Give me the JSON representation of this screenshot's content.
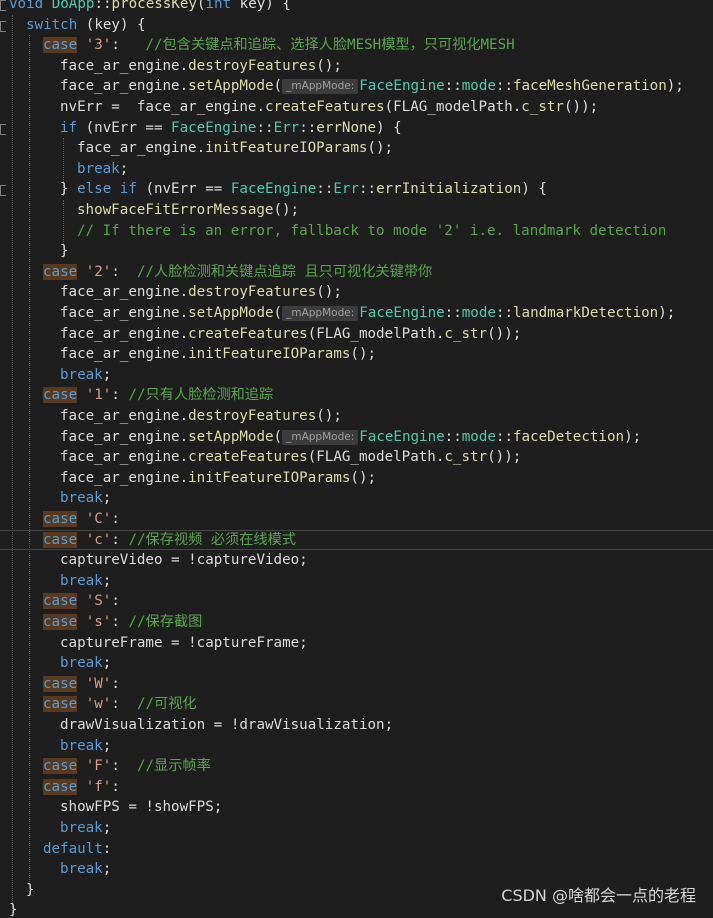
{
  "editor": {
    "colors": {
      "background": "#1e1e1e",
      "keyword": "#569cd6",
      "type": "#4ec9b0",
      "function": "#dcdcaa",
      "string": "#d69d85",
      "comment": "#57a64a",
      "text": "#dcdcdc",
      "case_highlight": "#623a1e",
      "param_hint": "#3c3c3c"
    },
    "current_line_index": 26,
    "lines": [
      {
        "indent": 0,
        "tokens": [
          {
            "t": "void ",
            "c": "kw"
          },
          {
            "t": "DoApp",
            "c": "cn"
          },
          {
            "t": "::",
            "c": "plain"
          },
          {
            "t": "processKey",
            "c": "fn"
          },
          {
            "t": "(",
            "c": "plain"
          },
          {
            "t": "int ",
            "c": "kw"
          },
          {
            "t": "key) {",
            "c": "plain"
          }
        ]
      },
      {
        "indent": 1,
        "tokens": [
          {
            "t": "switch ",
            "c": "kw"
          },
          {
            "t": "(key) {",
            "c": "plain"
          }
        ]
      },
      {
        "indent": 2,
        "tokens": [
          {
            "t": "case",
            "c": "casekw"
          },
          {
            "t": " ",
            "c": "plain"
          },
          {
            "t": "'3'",
            "c": "str"
          },
          {
            "t": ":   ",
            "c": "plain"
          },
          {
            "t": "//包含关键点和追踪、选择人脸MESH模型，只可视化MESH",
            "c": "cmt"
          }
        ]
      },
      {
        "indent": 3,
        "tokens": [
          {
            "t": "face_ar_engine.",
            "c": "plain"
          },
          {
            "t": "destroyFeatures",
            "c": "fn"
          },
          {
            "t": "();",
            "c": "plain"
          }
        ]
      },
      {
        "indent": 3,
        "tokens": [
          {
            "t": "face_ar_engine.",
            "c": "plain"
          },
          {
            "t": "setAppMode",
            "c": "fn"
          },
          {
            "t": "(",
            "c": "plain"
          },
          {
            "t": "_mAppMode:",
            "c": "hint"
          },
          {
            "t": "FaceEngine",
            "c": "cn"
          },
          {
            "t": "::",
            "c": "plain"
          },
          {
            "t": "mode",
            "c": "cn"
          },
          {
            "t": "::",
            "c": "plain"
          },
          {
            "t": "faceMeshGeneration",
            "c": "fn"
          },
          {
            "t": ");",
            "c": "plain"
          }
        ]
      },
      {
        "indent": 3,
        "tokens": [
          {
            "t": "nvErr =  face_ar_engine.",
            "c": "plain"
          },
          {
            "t": "createFeatures",
            "c": "fn"
          },
          {
            "t": "(FLAG_modelPath.",
            "c": "plain"
          },
          {
            "t": "c_str",
            "c": "fn"
          },
          {
            "t": "());",
            "c": "plain"
          }
        ]
      },
      {
        "indent": 3,
        "tokens": [
          {
            "t": "if ",
            "c": "kw"
          },
          {
            "t": "(nvErr == ",
            "c": "plain"
          },
          {
            "t": "FaceEngine",
            "c": "cn"
          },
          {
            "t": "::",
            "c": "plain"
          },
          {
            "t": "Err",
            "c": "cn"
          },
          {
            "t": "::",
            "c": "plain"
          },
          {
            "t": "errNone",
            "c": "fn"
          },
          {
            "t": ") {",
            "c": "plain"
          }
        ]
      },
      {
        "indent": 4,
        "tokens": [
          {
            "t": "face_ar_engine.",
            "c": "plain"
          },
          {
            "t": "initFeatureIOParams",
            "c": "fn"
          },
          {
            "t": "();",
            "c": "plain"
          }
        ]
      },
      {
        "indent": 4,
        "tokens": [
          {
            "t": "break",
            "c": "kw"
          },
          {
            "t": ";",
            "c": "plain"
          }
        ]
      },
      {
        "indent": 3,
        "tokens": [
          {
            "t": "} ",
            "c": "plain"
          },
          {
            "t": "else if ",
            "c": "kw"
          },
          {
            "t": "(nvErr == ",
            "c": "plain"
          },
          {
            "t": "FaceEngine",
            "c": "cn"
          },
          {
            "t": "::",
            "c": "plain"
          },
          {
            "t": "Err",
            "c": "cn"
          },
          {
            "t": "::",
            "c": "plain"
          },
          {
            "t": "errInitialization",
            "c": "fn"
          },
          {
            "t": ") {",
            "c": "plain"
          }
        ]
      },
      {
        "indent": 4,
        "tokens": [
          {
            "t": "showFaceFitErrorMessage",
            "c": "fn"
          },
          {
            "t": "();",
            "c": "plain"
          }
        ]
      },
      {
        "indent": 4,
        "tokens": [
          {
            "t": "// If there is an error, fallback to mode '2' i.e. landmark detection",
            "c": "cmt"
          }
        ]
      },
      {
        "indent": 3,
        "tokens": [
          {
            "t": "}",
            "c": "plain"
          }
        ]
      },
      {
        "indent": 2,
        "tokens": [
          {
            "t": "case",
            "c": "casekw"
          },
          {
            "t": " ",
            "c": "plain"
          },
          {
            "t": "'2'",
            "c": "str"
          },
          {
            "t": ":  ",
            "c": "plain"
          },
          {
            "t": "//人脸检测和关键点追踪 且只可视化关键带你",
            "c": "cmt"
          }
        ]
      },
      {
        "indent": 3,
        "tokens": [
          {
            "t": "face_ar_engine.",
            "c": "plain"
          },
          {
            "t": "destroyFeatures",
            "c": "fn"
          },
          {
            "t": "();",
            "c": "plain"
          }
        ]
      },
      {
        "indent": 3,
        "tokens": [
          {
            "t": "face_ar_engine.",
            "c": "plain"
          },
          {
            "t": "setAppMode",
            "c": "fn"
          },
          {
            "t": "(",
            "c": "plain"
          },
          {
            "t": "_mAppMode:",
            "c": "hint"
          },
          {
            "t": "FaceEngine",
            "c": "cn"
          },
          {
            "t": "::",
            "c": "plain"
          },
          {
            "t": "mode",
            "c": "cn"
          },
          {
            "t": "::",
            "c": "plain"
          },
          {
            "t": "landmarkDetection",
            "c": "fn"
          },
          {
            "t": ");",
            "c": "plain"
          }
        ]
      },
      {
        "indent": 3,
        "tokens": [
          {
            "t": "face_ar_engine.",
            "c": "plain"
          },
          {
            "t": "createFeatures",
            "c": "fn"
          },
          {
            "t": "(FLAG_modelPath.",
            "c": "plain"
          },
          {
            "t": "c_str",
            "c": "fn"
          },
          {
            "t": "());",
            "c": "plain"
          }
        ]
      },
      {
        "indent": 3,
        "tokens": [
          {
            "t": "face_ar_engine.",
            "c": "plain"
          },
          {
            "t": "initFeatureIOParams",
            "c": "fn"
          },
          {
            "t": "();",
            "c": "plain"
          }
        ]
      },
      {
        "indent": 3,
        "tokens": [
          {
            "t": "break",
            "c": "kw"
          },
          {
            "t": ";",
            "c": "plain"
          }
        ]
      },
      {
        "indent": 2,
        "tokens": [
          {
            "t": "case",
            "c": "casekw"
          },
          {
            "t": " ",
            "c": "plain"
          },
          {
            "t": "'1'",
            "c": "str"
          },
          {
            "t": ": ",
            "c": "plain"
          },
          {
            "t": "//只有人脸检测和追踪",
            "c": "cmt"
          }
        ]
      },
      {
        "indent": 3,
        "tokens": [
          {
            "t": "face_ar_engine.",
            "c": "plain"
          },
          {
            "t": "destroyFeatures",
            "c": "fn"
          },
          {
            "t": "();",
            "c": "plain"
          }
        ]
      },
      {
        "indent": 3,
        "tokens": [
          {
            "t": "face_ar_engine.",
            "c": "plain"
          },
          {
            "t": "setAppMode",
            "c": "fn"
          },
          {
            "t": "(",
            "c": "plain"
          },
          {
            "t": "_mAppMode:",
            "c": "hint"
          },
          {
            "t": "FaceEngine",
            "c": "cn"
          },
          {
            "t": "::",
            "c": "plain"
          },
          {
            "t": "mode",
            "c": "cn"
          },
          {
            "t": "::",
            "c": "plain"
          },
          {
            "t": "faceDetection",
            "c": "fn"
          },
          {
            "t": ");",
            "c": "plain"
          }
        ]
      },
      {
        "indent": 3,
        "tokens": [
          {
            "t": "face_ar_engine.",
            "c": "plain"
          },
          {
            "t": "createFeatures",
            "c": "fn"
          },
          {
            "t": "(FLAG_modelPath.",
            "c": "plain"
          },
          {
            "t": "c_str",
            "c": "fn"
          },
          {
            "t": "());",
            "c": "plain"
          }
        ]
      },
      {
        "indent": 3,
        "tokens": [
          {
            "t": "face_ar_engine.",
            "c": "plain"
          },
          {
            "t": "initFeatureIOParams",
            "c": "fn"
          },
          {
            "t": "();",
            "c": "plain"
          }
        ]
      },
      {
        "indent": 3,
        "tokens": [
          {
            "t": "break",
            "c": "kw"
          },
          {
            "t": ";",
            "c": "plain"
          }
        ]
      },
      {
        "indent": 2,
        "tokens": [
          {
            "t": "case",
            "c": "casekw"
          },
          {
            "t": " ",
            "c": "plain"
          },
          {
            "t": "'C'",
            "c": "str"
          },
          {
            "t": ":",
            "c": "plain"
          }
        ]
      },
      {
        "indent": 2,
        "tokens": [
          {
            "t": "case",
            "c": "casekw"
          },
          {
            "t": " ",
            "c": "plain"
          },
          {
            "t": "'c'",
            "c": "str"
          },
          {
            "t": ": ",
            "c": "plain"
          },
          {
            "t": "//保存视频 必须在线模式",
            "c": "cmt"
          }
        ]
      },
      {
        "indent": 3,
        "tokens": [
          {
            "t": "captureVideo = !captureVideo;",
            "c": "plain"
          }
        ]
      },
      {
        "indent": 3,
        "tokens": [
          {
            "t": "break",
            "c": "kw"
          },
          {
            "t": ";",
            "c": "plain"
          }
        ]
      },
      {
        "indent": 2,
        "tokens": [
          {
            "t": "case",
            "c": "casekw"
          },
          {
            "t": " ",
            "c": "plain"
          },
          {
            "t": "'S'",
            "c": "str"
          },
          {
            "t": ":",
            "c": "plain"
          }
        ]
      },
      {
        "indent": 2,
        "tokens": [
          {
            "t": "case",
            "c": "casekw"
          },
          {
            "t": " ",
            "c": "plain"
          },
          {
            "t": "'s'",
            "c": "str"
          },
          {
            "t": ": ",
            "c": "plain"
          },
          {
            "t": "//保存截图",
            "c": "cmt"
          }
        ]
      },
      {
        "indent": 3,
        "tokens": [
          {
            "t": "captureFrame = !captureFrame;",
            "c": "plain"
          }
        ]
      },
      {
        "indent": 3,
        "tokens": [
          {
            "t": "break",
            "c": "kw"
          },
          {
            "t": ";",
            "c": "plain"
          }
        ]
      },
      {
        "indent": 2,
        "tokens": [
          {
            "t": "case",
            "c": "casekw"
          },
          {
            "t": " ",
            "c": "plain"
          },
          {
            "t": "'W'",
            "c": "str"
          },
          {
            "t": ":",
            "c": "plain"
          }
        ]
      },
      {
        "indent": 2,
        "tokens": [
          {
            "t": "case",
            "c": "casekw"
          },
          {
            "t": " ",
            "c": "plain"
          },
          {
            "t": "'w'",
            "c": "str"
          },
          {
            "t": ":  ",
            "c": "plain"
          },
          {
            "t": "//可视化",
            "c": "cmt"
          }
        ]
      },
      {
        "indent": 3,
        "tokens": [
          {
            "t": "drawVisualization = !drawVisualization;",
            "c": "plain"
          }
        ]
      },
      {
        "indent": 3,
        "tokens": [
          {
            "t": "break",
            "c": "kw"
          },
          {
            "t": ";",
            "c": "plain"
          }
        ]
      },
      {
        "indent": 2,
        "tokens": [
          {
            "t": "case",
            "c": "casekw"
          },
          {
            "t": " ",
            "c": "plain"
          },
          {
            "t": "'F'",
            "c": "str"
          },
          {
            "t": ":  ",
            "c": "plain"
          },
          {
            "t": "//显示帧率",
            "c": "cmt"
          }
        ]
      },
      {
        "indent": 2,
        "tokens": [
          {
            "t": "case",
            "c": "casekw"
          },
          {
            "t": " ",
            "c": "plain"
          },
          {
            "t": "'f'",
            "c": "str"
          },
          {
            "t": ":",
            "c": "plain"
          }
        ]
      },
      {
        "indent": 3,
        "tokens": [
          {
            "t": "showFPS = !showFPS;",
            "c": "plain"
          }
        ]
      },
      {
        "indent": 3,
        "tokens": [
          {
            "t": "break",
            "c": "kw"
          },
          {
            "t": ";",
            "c": "plain"
          }
        ]
      },
      {
        "indent": 2,
        "tokens": [
          {
            "t": "default",
            "c": "kw"
          },
          {
            "t": ":",
            "c": "plain"
          }
        ]
      },
      {
        "indent": 3,
        "tokens": [
          {
            "t": "break",
            "c": "kw"
          },
          {
            "t": ";",
            "c": "plain"
          }
        ]
      },
      {
        "indent": 1,
        "tokens": [
          {
            "t": "}",
            "c": "plain"
          }
        ]
      },
      {
        "indent": 0,
        "tokens": [
          {
            "t": "}",
            "c": "plain"
          }
        ]
      }
    ]
  },
  "watermark": {
    "text": "CSDN @啥都会一点的老程"
  }
}
